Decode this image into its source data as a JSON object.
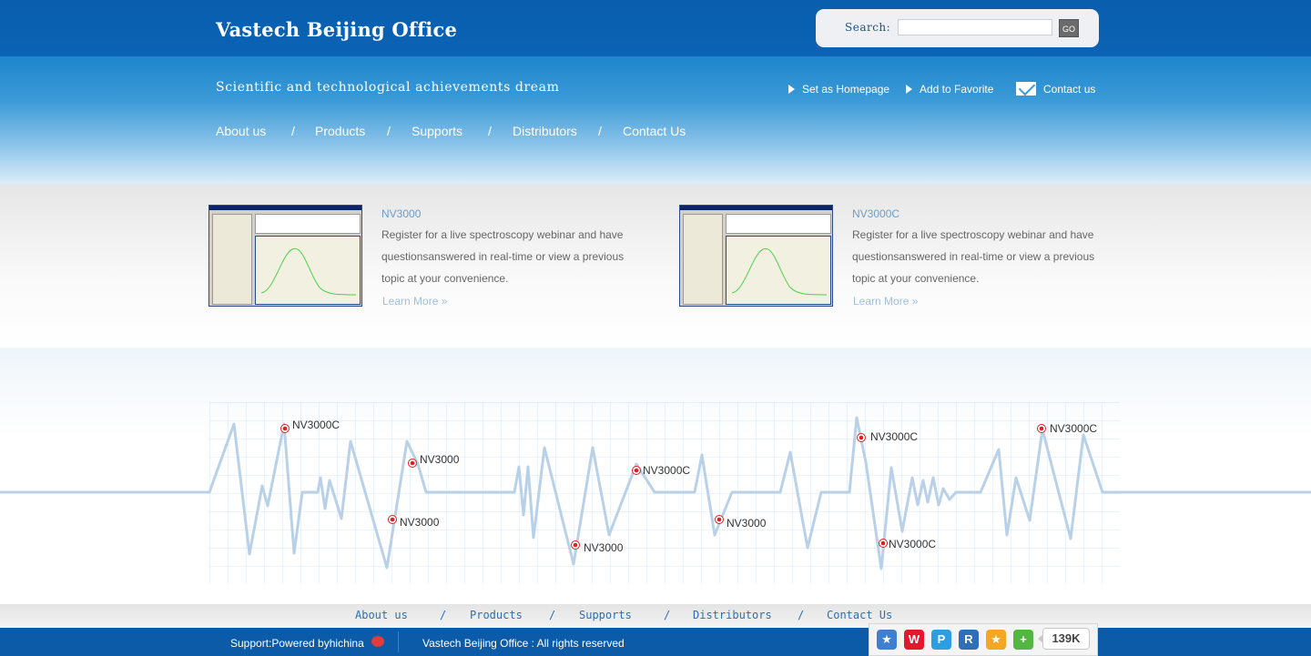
{
  "header": {
    "brand": "Vastech Beijing Office",
    "search_label": "Search:",
    "search_value": "",
    "search_button": "GO"
  },
  "banner": {
    "tagline": "Scientific and technological achievements dream",
    "quick_links": [
      "Set as Homepage",
      "Add to Favorite",
      "Contact us"
    ]
  },
  "nav": {
    "items": [
      "About us",
      "Products",
      "Supports",
      "Distributors",
      "Contact Us"
    ],
    "separator": "/"
  },
  "products": [
    {
      "title": "NV3000",
      "description": "Register for a live spectroscopy webinar and have  questionsanswered in real-time or view a previous topic at your convenience.",
      "more": "Learn More »"
    },
    {
      "title": "NV3000C",
      "description": "Register for a live spectroscopy webinar and have  questionsanswered in real-time or view a previous topic at your convenience.",
      "more": "Learn More »"
    }
  ],
  "wave_markers": [
    "NV3000C",
    "NV3000",
    "NV3000",
    "NV3000",
    "NV3000C",
    "NV3000",
    "NV3000C",
    "NV3000C",
    "NV3000C"
  ],
  "footer_nav": {
    "items": [
      "About us",
      "Products",
      "Supports",
      "Distributors",
      "Contact Us"
    ],
    "separator": "/"
  },
  "bottom": {
    "support": "Support:Powered byhichina",
    "copyright": "Vastech Beijing Office : All rights reserved"
  },
  "share": {
    "icons": [
      "favorite-star-icon",
      "weibo-icon",
      "pengyou-icon",
      "renren-icon",
      "qzone-icon",
      "share-more-icon"
    ],
    "count": "139K"
  },
  "colors": {
    "header_blue": "#0b63b3",
    "accent_link": "#6d9cc8",
    "wave_line": "#b9d1e8",
    "marker_red": "#e02020"
  }
}
